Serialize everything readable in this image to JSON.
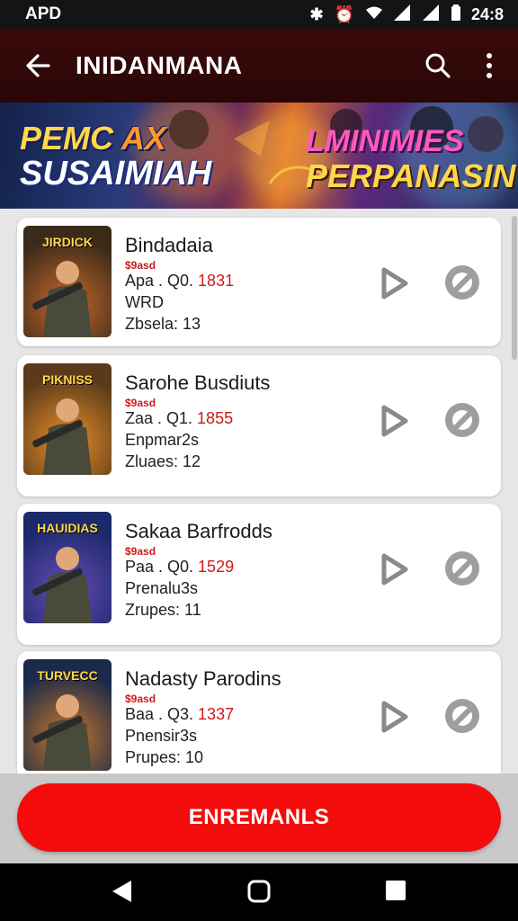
{
  "status_bar": {
    "left_text": "APD",
    "time": "24:8"
  },
  "app_bar": {
    "title": "INIDANMANA"
  },
  "banner": {
    "left_line1_a": "PEMC",
    "left_line1_b": "AX",
    "left_line2": "SUSAIMIAH",
    "right_line1": "LMINIMIES",
    "right_line2": "PERPANASIN"
  },
  "games": [
    {
      "name": "Bindadaia",
      "tag": "$9asd",
      "meta_prefix": "Apa . Q0. ",
      "meta_value": "1831",
      "line3": "WRD",
      "line4": "Zbsela: 13",
      "thumb_text": "JIRDICK",
      "thumb_colors": [
        "#3a2a1a",
        "#c86a2a"
      ]
    },
    {
      "name": "Sarohe Busdiuts",
      "tag": "$9asd",
      "meta_prefix": "Zaa . Q1. ",
      "meta_value": "1855",
      "line3": "Enpmar2s",
      "line4": "Zluaes: 12",
      "thumb_text": "PIKNISS",
      "thumb_colors": [
        "#5a3a1a",
        "#e8902a"
      ]
    },
    {
      "name": "Sakaa Barfrodds",
      "tag": "$9asd",
      "meta_prefix": "Paa . Q0. ",
      "meta_value": "1529",
      "line3": "Prenalu3s",
      "line4": "Zrupes: 11",
      "thumb_text": "HAUIDIAS",
      "thumb_colors": [
        "#1a2a6a",
        "#6a4ab8"
      ]
    },
    {
      "name": "Nadasty Parodins",
      "tag": "$9asd",
      "meta_prefix": "Baa . Q3. ",
      "meta_value": "1337",
      "line3": "Pnensir3s",
      "line4": "Prupes: 10",
      "thumb_text": "TURVECC",
      "thumb_colors": [
        "#1a2a4a",
        "#c8782a"
      ]
    }
  ],
  "cta": {
    "label": "ENREMANLS"
  },
  "colors": {
    "accent": "#f40b0b",
    "app_bar": "#3a0a0a",
    "price_red": "#d01818"
  }
}
